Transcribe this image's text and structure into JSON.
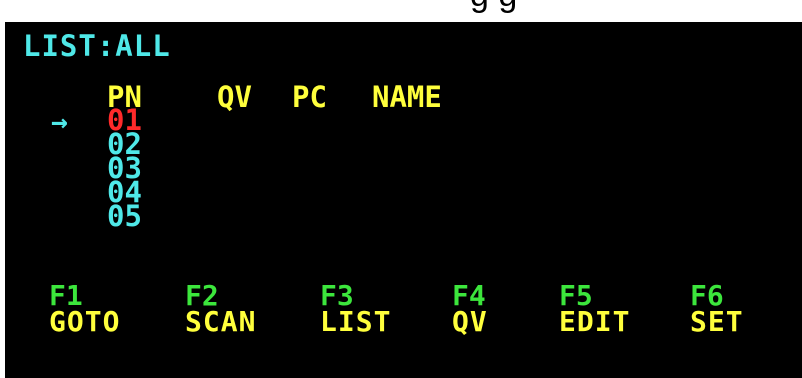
{
  "top_cut_text": "g g",
  "screen": {
    "title": "LIST:ALL",
    "columns": {
      "pn": "PN",
      "qv": "QV",
      "pc": "PC",
      "name": "NAME"
    },
    "cursor_glyph": "→",
    "rows": [
      "01",
      "02",
      "03",
      "04",
      "05"
    ],
    "selected_row": "01",
    "function_keys": [
      {
        "key": "F1",
        "label": "GOTO"
      },
      {
        "key": "F2",
        "label": "SCAN"
      },
      {
        "key": "F3",
        "label": "LIST"
      },
      {
        "key": "F4",
        "label": "QV"
      },
      {
        "key": "F5",
        "label": "EDIT"
      },
      {
        "key": "F6",
        "label": "SET"
      }
    ]
  },
  "colors": {
    "background": "#000000",
    "title": "#4fe8e8",
    "header": "#ffff3c",
    "row": "#4fe8e8",
    "selected_row": "#ff2a2a",
    "fkey_number": "#3ce63c",
    "fkey_label": "#ffff3c"
  }
}
